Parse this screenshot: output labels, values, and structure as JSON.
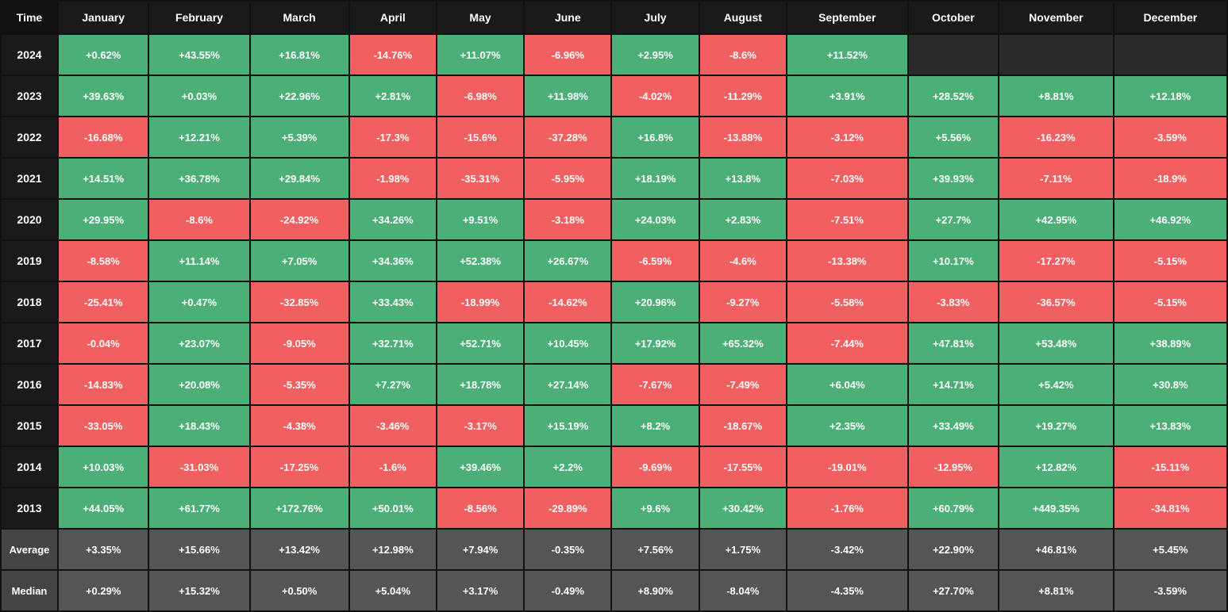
{
  "headers": [
    "Time",
    "January",
    "February",
    "March",
    "April",
    "May",
    "June",
    "July",
    "August",
    "September",
    "October",
    "November",
    "December"
  ],
  "rows": [
    {
      "year": "2024",
      "cells": [
        "+0.62%",
        "+43.55%",
        "+16.81%",
        "-14.76%",
        "+11.07%",
        "-6.96%",
        "+2.95%",
        "-8.6%",
        "+11.52%",
        "",
        "",
        ""
      ]
    },
    {
      "year": "2023",
      "cells": [
        "+39.63%",
        "+0.03%",
        "+22.96%",
        "+2.81%",
        "-6.98%",
        "+11.98%",
        "-4.02%",
        "-11.29%",
        "+3.91%",
        "+28.52%",
        "+8.81%",
        "+12.18%"
      ]
    },
    {
      "year": "2022",
      "cells": [
        "-16.68%",
        "+12.21%",
        "+5.39%",
        "-17.3%",
        "-15.6%",
        "-37.28%",
        "+16.8%",
        "-13.88%",
        "-3.12%",
        "+5.56%",
        "-16.23%",
        "-3.59%"
      ]
    },
    {
      "year": "2021",
      "cells": [
        "+14.51%",
        "+36.78%",
        "+29.84%",
        "-1.98%",
        "-35.31%",
        "-5.95%",
        "+18.19%",
        "+13.8%",
        "-7.03%",
        "+39.93%",
        "-7.11%",
        "-18.9%"
      ]
    },
    {
      "year": "2020",
      "cells": [
        "+29.95%",
        "-8.6%",
        "-24.92%",
        "+34.26%",
        "+9.51%",
        "-3.18%",
        "+24.03%",
        "+2.83%",
        "-7.51%",
        "+27.7%",
        "+42.95%",
        "+46.92%"
      ]
    },
    {
      "year": "2019",
      "cells": [
        "-8.58%",
        "+11.14%",
        "+7.05%",
        "+34.36%",
        "+52.38%",
        "+26.67%",
        "-6.59%",
        "-4.6%",
        "-13.38%",
        "+10.17%",
        "-17.27%",
        "-5.15%"
      ]
    },
    {
      "year": "2018",
      "cells": [
        "-25.41%",
        "+0.47%",
        "-32.85%",
        "+33.43%",
        "-18.99%",
        "-14.62%",
        "+20.96%",
        "-9.27%",
        "-5.58%",
        "-3.83%",
        "-36.57%",
        "-5.15%"
      ]
    },
    {
      "year": "2017",
      "cells": [
        "-0.04%",
        "+23.07%",
        "-9.05%",
        "+32.71%",
        "+52.71%",
        "+10.45%",
        "+17.92%",
        "+65.32%",
        "-7.44%",
        "+47.81%",
        "+53.48%",
        "+38.89%"
      ]
    },
    {
      "year": "2016",
      "cells": [
        "-14.83%",
        "+20.08%",
        "-5.35%",
        "+7.27%",
        "+18.78%",
        "+27.14%",
        "-7.67%",
        "-7.49%",
        "+6.04%",
        "+14.71%",
        "+5.42%",
        "+30.8%"
      ]
    },
    {
      "year": "2015",
      "cells": [
        "-33.05%",
        "+18.43%",
        "-4.38%",
        "-3.46%",
        "-3.17%",
        "+15.19%",
        "+8.2%",
        "-18.67%",
        "+2.35%",
        "+33.49%",
        "+19.27%",
        "+13.83%"
      ]
    },
    {
      "year": "2014",
      "cells": [
        "+10.03%",
        "-31.03%",
        "-17.25%",
        "-1.6%",
        "+39.46%",
        "+2.2%",
        "-9.69%",
        "-17.55%",
        "-19.01%",
        "-12.95%",
        "+12.82%",
        "-15.11%"
      ]
    },
    {
      "year": "2013",
      "cells": [
        "+44.05%",
        "+61.77%",
        "+172.76%",
        "+50.01%",
        "-8.56%",
        "-29.89%",
        "+9.6%",
        "+30.42%",
        "-1.76%",
        "+60.79%",
        "+449.35%",
        "-34.81%"
      ]
    }
  ],
  "average": {
    "label": "Average",
    "cells": [
      "+3.35%",
      "+15.66%",
      "+13.42%",
      "+12.98%",
      "+7.94%",
      "-0.35%",
      "+7.56%",
      "+1.75%",
      "-3.42%",
      "+22.90%",
      "+46.81%",
      "+5.45%"
    ]
  },
  "median": {
    "label": "Median",
    "cells": [
      "+0.29%",
      "+15.32%",
      "+0.50%",
      "+5.04%",
      "+3.17%",
      "-0.49%",
      "+8.90%",
      "-8.04%",
      "-4.35%",
      "+27.70%",
      "+8.81%",
      "-3.59%"
    ]
  }
}
